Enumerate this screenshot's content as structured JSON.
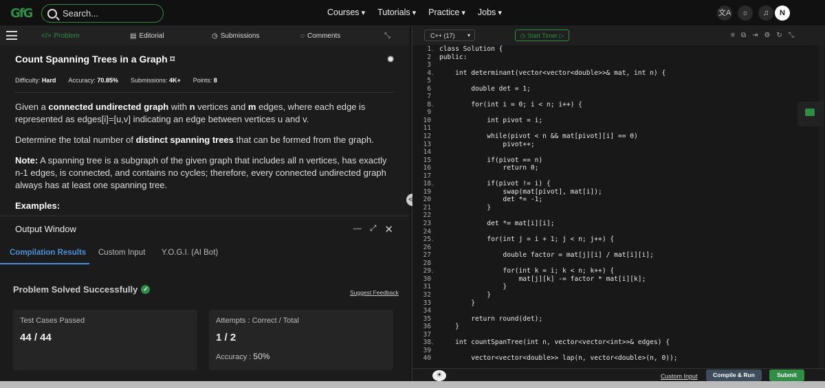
{
  "top": {
    "logo": "GfG",
    "search_placeholder": "Search...",
    "nav": [
      "Courses",
      "Tutorials",
      "Practice",
      "Jobs"
    ],
    "avatar": "N"
  },
  "tabs": {
    "problem": "Problem",
    "editorial": "Editorial",
    "submissions": "Submissions",
    "comments": "Comments"
  },
  "problem": {
    "title": "Count Spanning Trees in a Graph",
    "difficulty_label": "Difficulty:",
    "difficulty": "Hard",
    "accuracy_label": "Accuracy:",
    "accuracy": "70.85%",
    "submissions_label": "Submissions:",
    "submissions": "4K+",
    "points_label": "Points:",
    "points": "8",
    "p1_a": "Given a ",
    "p1_b": "connected undirected graph",
    "p1_c": " with ",
    "p1_d": "n",
    "p1_e": " vertices and ",
    "p1_f": "m",
    "p1_g": " edges, where each edge is represented as edges[i]=[u,v]  indicating an edge between vertices u and v.",
    "p2_a": "Determine the total number of ",
    "p2_b": "distinct spanning trees",
    "p2_c": " that can be formed from the graph.",
    "p3_a": "Note:",
    "p3_b": " A spanning tree is a subgraph of the given graph that includes all n vertices, has exactly n-1 edges, is connected, and contains no cycles; therefore, every connected undirected graph always has at least one spanning tree.",
    "examples": "Examples:"
  },
  "output": {
    "title": "Output Window",
    "tabs": [
      "Compilation Results",
      "Custom Input",
      "Y.O.G.I. (AI Bot)"
    ],
    "status": "Problem Solved Successfully",
    "suggest": "Suggest Feedback",
    "tests_label": "Test Cases Passed",
    "tests_value": "44 / 44",
    "attempts_label": "Attempts : Correct / Total",
    "attempts_value": "1 / 2",
    "accuracy_label": "Accuracy :",
    "accuracy_value": "50%"
  },
  "editor": {
    "language": "C++ (17)",
    "timer": "Start Timer",
    "custom_input": "Custom Input",
    "compile": "Compile & Run",
    "submit": "Submit",
    "lines": [
      "class Solution {",
      "public:",
      "",
      "    int determinant(vector<vector<double>>& mat, int n) {",
      "",
      "        double det = 1;",
      "",
      "        for(int i = 0; i < n; i++) {",
      "",
      "            int pivot = i;",
      "",
      "            while(pivot < n && mat[pivot][i] == 0)",
      "                pivot++;",
      "",
      "            if(pivot == n)",
      "                return 0;",
      "",
      "            if(pivot != i) {",
      "                swap(mat[pivot], mat[i]);",
      "                det *= -1;",
      "            }",
      "",
      "            det *= mat[i][i];",
      "",
      "            for(int j = i + 1; j < n; j++) {",
      "",
      "                double factor = mat[j][i] / mat[i][i];",
      "",
      "                for(int k = i; k < n; k++) {",
      "                    mat[j][k] -= factor * mat[i][k];",
      "                }",
      "            }",
      "        }",
      "",
      "        return round(det);",
      "    }",
      "",
      "    int countSpanTree(int n, vector<vector<int>>& edges) {",
      "",
      "        vector<vector<double>> lap(n, vector<double>(n, 0));"
    ],
    "fold_lines": [
      1,
      4,
      8,
      18,
      25,
      29,
      38
    ]
  }
}
